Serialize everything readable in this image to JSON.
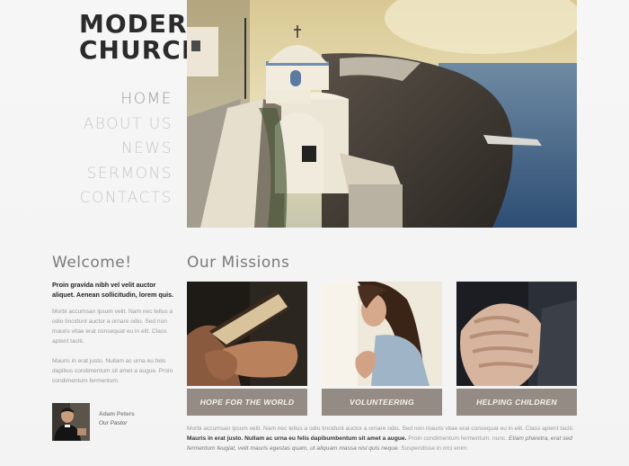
{
  "logo": {
    "line1": "MODERN",
    "line2": "CHURCH"
  },
  "nav": {
    "items": [
      "HOME",
      "ABOUT US",
      "NEWS",
      "SERMONS",
      "CONTACTS"
    ]
  },
  "welcome": {
    "title": "Welcome!",
    "lead": "Proin gravida nibh vel velit auctor aliquet. Aenean sollicitudin, lorem quis.",
    "p1": "Morbi accumsan ipsum velit. Nam nec tellus a odio tincidunt auctor a ornare odio. Sed non  mauris vitae erat consequat eu in elit. Class aptent taciti.",
    "p2": "Mauris in erat justo. Nullam ac urna eu felis dapibus condimentum sit amet a augue. Proin condimentum fermentum."
  },
  "pastor": {
    "name": "Adam Peters",
    "role": "Our Pastor"
  },
  "missions": {
    "title": "Our Missions",
    "cards": [
      {
        "label": "HOPE FOR THE WORLD"
      },
      {
        "label": "VOLUNTEERING"
      },
      {
        "label": "HELPING CHILDREN"
      }
    ],
    "text_plain1": "Morbi accumsan ipsum velit. Nam nec tellus a odio tincidunt auctor a ornare odio. Sed non  mauris vitae erat consequat eu in elit. Class aptent taciti. ",
    "text_bold": "Mauris in erat justo. Nullam ac urna eu felis dapibumbentum sit amet a augue.",
    "text_plain2": " Proin condimentum fermentum. nunc. ",
    "text_italic": "Etiam pharetra, erat sed fermentum feugiat, velit mauris egestas quam, ut aliquam massa nisl quis neque.",
    "text_plain3": " Suspendisse in orci enim."
  }
}
